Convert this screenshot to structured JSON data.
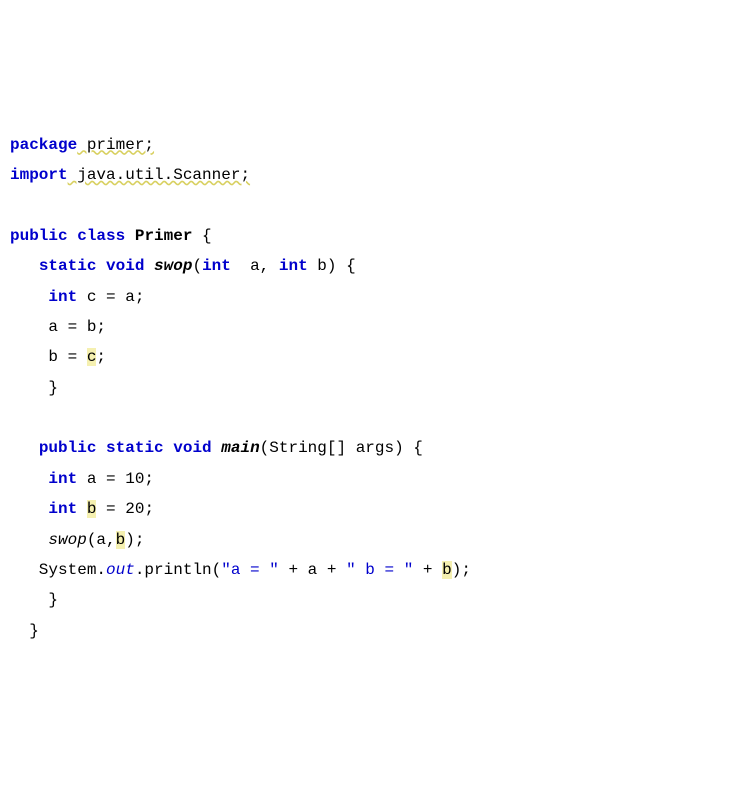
{
  "code": {
    "l1_kw1": "package",
    "l1_pkg": " primer;",
    "l2_kw1": "import",
    "l2_pkg": " java.util.Scanner;",
    "l4_kw1": "public",
    "l4_kw2": "class",
    "l4_cls": "Primer",
    "l4_tail": " {",
    "l5_pre": "   ",
    "l5_kw1": "static",
    "l5_kw2": "void",
    "l5_mth": "swop",
    "l5_sig1": "(",
    "l5_kw3": "int",
    "l5_sig2": "  a, ",
    "l5_kw4": "int",
    "l5_sig3": " b) {",
    "l6_pre": "    ",
    "l6_kw1": "int",
    "l6_rest": " c = a;",
    "l7": "    a = b;",
    "l8_pre": "    b = ",
    "l8_hl": "c",
    "l8_tail": ";",
    "l9": "    }",
    "l11_pre": "   ",
    "l11_kw1": "public",
    "l11_kw2": "static",
    "l11_kw3": "void",
    "l11_mth": "main",
    "l11_sig": "(String[] args) {",
    "l12_pre": "    ",
    "l12_kw1": "int",
    "l12_rest": " a = 10;",
    "l13_pre": "    ",
    "l13_kw1": "int",
    "l13_sp": " ",
    "l13_hl": "b",
    "l13_rest": " = 20;",
    "l14_pre": "    ",
    "l14_call": "swop",
    "l14_args1": "(a,",
    "l14_hl": "b",
    "l14_args2": ");",
    "l15_pre": "   System.",
    "l15_fld": "out",
    "l15_mid": ".println(",
    "l15_str1": "\"a = \"",
    "l15_plus1": " + a + ",
    "l15_str2": "\" b = \"",
    "l15_plus2": " + ",
    "l15_hl": "b",
    "l15_tail": ");",
    "l16": "    }",
    "l17": "  }"
  }
}
